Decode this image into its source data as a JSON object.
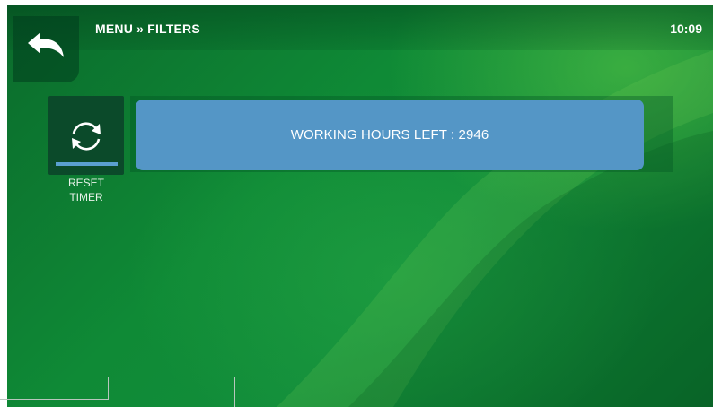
{
  "header": {
    "breadcrumb": "MENU » FILTERS",
    "time": "10:09",
    "back_icon": "back-arrow-icon"
  },
  "filters": {
    "reset_button": {
      "icon": "refresh-icon",
      "label_line1": "RESET",
      "label_line2": "TIMER"
    },
    "working_hours_text": "WORKING HOURS LEFT : 2946"
  },
  "colors": {
    "background": "#0f8a36",
    "panel": "#5496c6",
    "accent": "#5aa0d0",
    "button_dark": "#0b4a2a"
  }
}
